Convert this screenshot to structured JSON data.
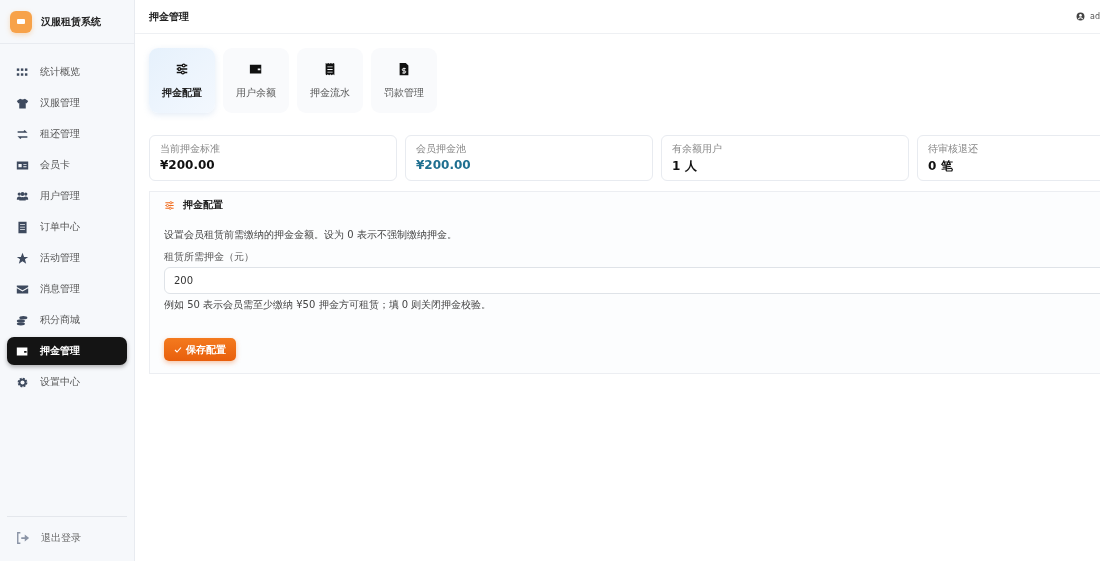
{
  "app": {
    "name": "汉服租赁系统"
  },
  "sidebar": {
    "items": [
      {
        "label": "统计概览",
        "selected": false
      },
      {
        "label": "汉服管理",
        "selected": false
      },
      {
        "label": "租还管理",
        "selected": false
      },
      {
        "label": "会员卡",
        "selected": false
      },
      {
        "label": "用户管理",
        "selected": false
      },
      {
        "label": "订单中心",
        "selected": false
      },
      {
        "label": "活动管理",
        "selected": false
      },
      {
        "label": "消息管理",
        "selected": false
      },
      {
        "label": "积分商城",
        "selected": false
      },
      {
        "label": "押金管理",
        "selected": true
      },
      {
        "label": "设置中心",
        "selected": false
      }
    ],
    "logout": "退出登录"
  },
  "header": {
    "title": "押金管理",
    "user": "ad"
  },
  "tabs": [
    {
      "label": "押金配置",
      "selected": true
    },
    {
      "label": "用户余额",
      "selected": false
    },
    {
      "label": "押金流水",
      "selected": false
    },
    {
      "label": "罚款管理",
      "selected": false
    }
  ],
  "stats": [
    {
      "label": "当前押金标准",
      "value": "¥200.00",
      "highlighted": false
    },
    {
      "label": "会员押金池",
      "value": "¥200.00",
      "highlighted": true
    },
    {
      "label": "有余额用户",
      "value": "1 人",
      "highlighted": false
    },
    {
      "label": "待审核退还",
      "value": "0 笔",
      "highlighted": false
    }
  ],
  "config": {
    "title": "押金配置",
    "description": "设置会员租赁前需缴纳的押金金额。设为 0 表示不强制缴纳押金。",
    "field_label": "租赁所需押金（元）",
    "value": "200",
    "hint": "例如 50 表示会员需至少缴纳 ¥50 押金方可租赁；填 0 则关闭押金校验。",
    "save_button": "保存配置"
  }
}
